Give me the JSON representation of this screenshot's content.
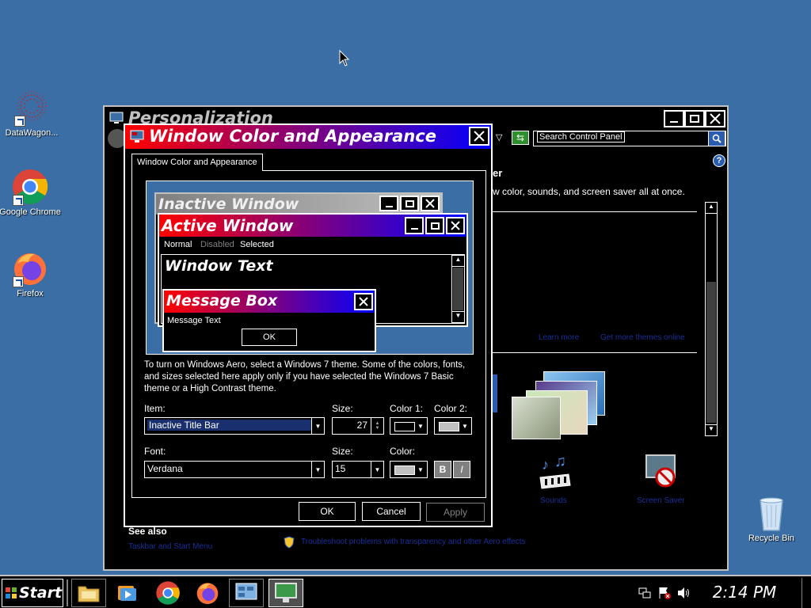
{
  "desktop": {
    "icons": [
      {
        "label": "DataWagon..."
      },
      {
        "label": "Google Chrome"
      },
      {
        "label": "Firefox"
      },
      {
        "label": "Recycle Bin"
      }
    ]
  },
  "personalization": {
    "title": "Personalization",
    "search_placeholder": "Search Control Panel",
    "heading_fragment": "er",
    "desc_fragment": "w color, sounds, and screen saver all at once.",
    "links": [
      "Learn more",
      "Get more themes online"
    ],
    "see_also_label": "See also",
    "see_also_link": "Taskbar and Start Menu",
    "bottom_link": "Troubleshoot problems with transparency and other Aero effects",
    "icon_labels": [
      "Sounds",
      "Screen Saver"
    ]
  },
  "dialog": {
    "title": "Window Color and Appearance",
    "tab_label": "Window Color and Appearance",
    "preview": {
      "inactive_title": "Inactive Window",
      "active_title": "Active Window",
      "menu_normal": "Normal",
      "menu_disabled": "Disabled",
      "menu_selected": "Selected",
      "window_text": "Window Text",
      "msgbox_title": "Message Box",
      "msgbox_text": "Message Text",
      "msgbox_ok": "OK"
    },
    "info_text": "To turn on Windows Aero, select a Windows 7 theme.  Some of the colors, fonts, and sizes selected here apply only if you have selected the Windows 7 Basic theme or a High Contrast theme.",
    "item_label": "Item:",
    "item_value": "Inactive Title Bar",
    "size_label": "Size:",
    "size_value": "27",
    "color1_label": "Color 1:",
    "color2_label": "Color 2:",
    "color1_value": "#000000",
    "color2_value": "#c0c0c0",
    "font_label": "Font:",
    "font_value": "Verdana",
    "font_size_label": "Size:",
    "font_size_value": "15",
    "font_color_label": "Color:",
    "font_color_value": "#c0c0c0",
    "bold_label": "B",
    "italic_label": "I",
    "ok": "OK",
    "cancel": "Cancel",
    "apply": "Apply"
  },
  "taskbar": {
    "start_label": "Start",
    "clock": "2:14 PM"
  },
  "colors": {
    "desktop": "#3a6ea5",
    "active_title_start": "#ff0000",
    "active_title_end": "#0000ff",
    "dim_link": "#1a2f99"
  }
}
